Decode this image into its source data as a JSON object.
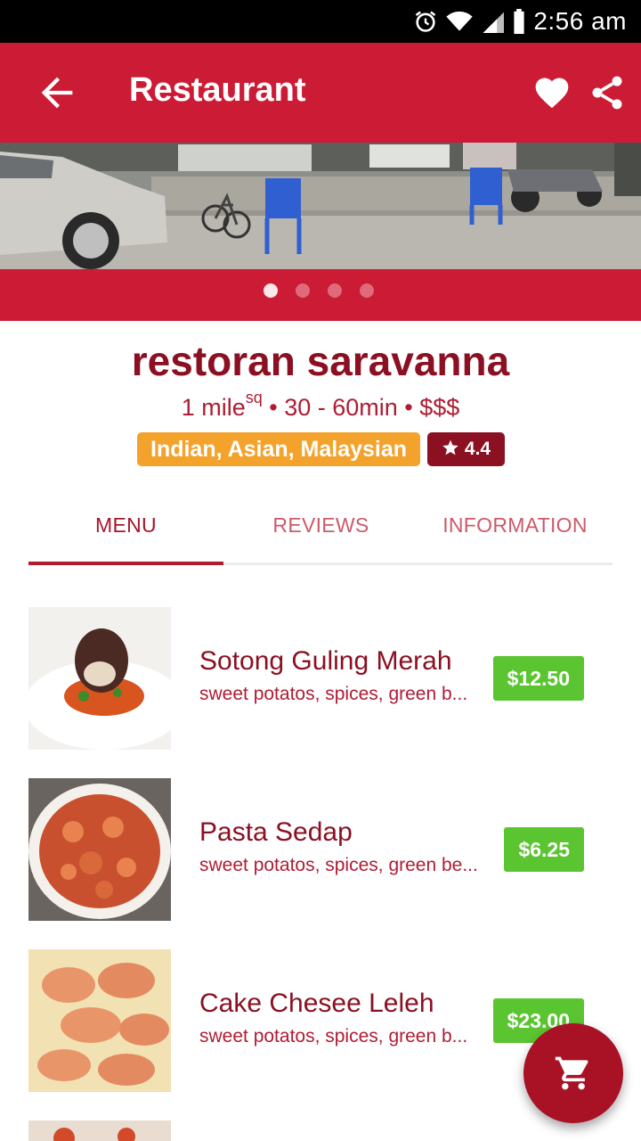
{
  "status_bar": {
    "time": "2:56 am"
  },
  "app_bar": {
    "title": "Restaurant"
  },
  "carousel": {
    "page_count": 4,
    "active_page": 1
  },
  "restaurant": {
    "name": "restoran saravanna",
    "distance": "1 mile",
    "distance_sup": "sq",
    "meta_rest": " • 30 - 60min • $$$",
    "cuisines": "Indian, Asian, Malaysian",
    "rating": "4.4"
  },
  "tabs": [
    {
      "label": "MENU",
      "active": true
    },
    {
      "label": "REVIEWS",
      "active": false
    },
    {
      "label": "INFORMATION",
      "active": false
    }
  ],
  "menu_items": [
    {
      "name": "Sotong Guling Merah",
      "description": "sweet potatos, spices, green b...",
      "price": "$12.50"
    },
    {
      "name": "Pasta Sedap",
      "description": "sweet potatos, spices, green be...",
      "price": "$6.25"
    },
    {
      "name": "Cake Chesee Leleh",
      "description": "sweet potatos, spices, green b...",
      "price": "$23.00"
    }
  ],
  "colors": {
    "primary": "#cc1b35",
    "dark_primary": "#8a1022",
    "cuisine_tag": "#f3a22c",
    "price_tag": "#5bc531"
  },
  "icons": [
    "alarm-icon",
    "wifi-icon",
    "signal-icon",
    "battery-icon",
    "back-arrow-icon",
    "heart-icon",
    "share-icon",
    "star-icon",
    "cart-icon"
  ]
}
